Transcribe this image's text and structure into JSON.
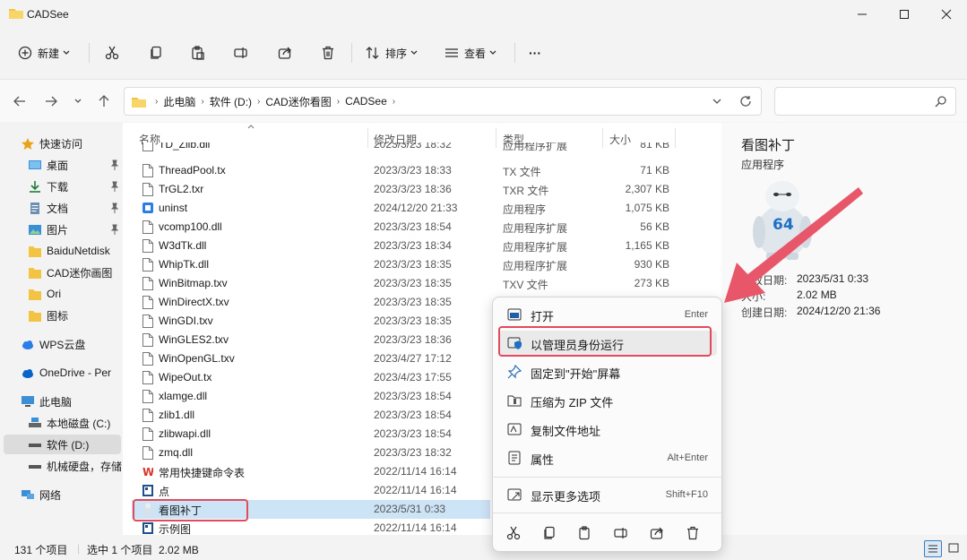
{
  "window": {
    "title": "CADSee"
  },
  "toolbar": {
    "new_label": "新建",
    "sort_label": "排序",
    "view_label": "查看",
    "more_label": "···"
  },
  "address": {
    "crumbs": [
      "此电脑",
      "软件 (D:)",
      "CAD迷你看图",
      "CADSee"
    ]
  },
  "sidebar": {
    "items": [
      {
        "label": "快速访问",
        "icon": "star-icon",
        "pinned": false
      },
      {
        "label": "桌面",
        "icon": "desktop-icon",
        "pinned": true
      },
      {
        "label": "下载",
        "icon": "download-icon",
        "pinned": true
      },
      {
        "label": "文档",
        "icon": "documents-icon",
        "pinned": true
      },
      {
        "label": "图片",
        "icon": "pictures-icon",
        "pinned": true
      },
      {
        "label": "BaiduNetdisk",
        "icon": "folder-icon",
        "pinned": false
      },
      {
        "label": "CAD迷你画图",
        "icon": "folder-icon",
        "pinned": false
      },
      {
        "label": "Ori",
        "icon": "folder-icon",
        "pinned": false
      },
      {
        "label": "图标",
        "icon": "folder-icon",
        "pinned": false
      },
      {
        "label": "WPS云盘",
        "icon": "cloud-icon",
        "pinned": false
      },
      {
        "label": "OneDrive - Per",
        "icon": "cloud-icon",
        "pinned": false
      },
      {
        "label": "此电脑",
        "icon": "computer-icon",
        "pinned": false
      },
      {
        "label": "本地磁盘 (C:)",
        "icon": "drive-icon",
        "pinned": false
      },
      {
        "label": "软件 (D:)",
        "icon": "drive-icon",
        "pinned": false
      },
      {
        "label": "机械硬盘，存储",
        "icon": "drive-icon",
        "pinned": false
      },
      {
        "label": "网络",
        "icon": "network-icon",
        "pinned": false
      }
    ]
  },
  "filelist": {
    "headers": {
      "name": "名称",
      "date": "修改日期",
      "type": "类型",
      "size": "大小"
    },
    "rows": [
      {
        "name": "TD_Zlib.dll",
        "date": "2023/3/23 18:32",
        "type": "应用程序扩展",
        "size": "81 KB",
        "icon": "file-icon"
      },
      {
        "name": "ThreadPool.tx",
        "date": "2023/3/23 18:33",
        "type": "TX 文件",
        "size": "71 KB",
        "icon": "file-icon"
      },
      {
        "name": "TrGL2.txr",
        "date": "2023/3/23 18:36",
        "type": "TXR 文件",
        "size": "2,307 KB",
        "icon": "file-icon"
      },
      {
        "name": "uninst",
        "date": "2024/12/20 21:33",
        "type": "应用程序",
        "size": "1,075 KB",
        "icon": "uninstaller-icon"
      },
      {
        "name": "vcomp100.dll",
        "date": "2023/3/23 18:54",
        "type": "应用程序扩展",
        "size": "56 KB",
        "icon": "file-icon"
      },
      {
        "name": "W3dTk.dll",
        "date": "2023/3/23 18:34",
        "type": "应用程序扩展",
        "size": "1,165 KB",
        "icon": "file-icon"
      },
      {
        "name": "WhipTk.dll",
        "date": "2023/3/23 18:35",
        "type": "应用程序扩展",
        "size": "930 KB",
        "icon": "file-icon"
      },
      {
        "name": "WinBitmap.txv",
        "date": "2023/3/23 18:35",
        "type": "TXV 文件",
        "size": "273 KB",
        "icon": "file-icon"
      },
      {
        "name": "WinDirectX.txv",
        "date": "2023/3/23 18:35",
        "type": "",
        "size": "",
        "icon": "file-icon"
      },
      {
        "name": "WinGDI.txv",
        "date": "2023/3/23 18:35",
        "type": "",
        "size": "",
        "icon": "file-icon"
      },
      {
        "name": "WinGLES2.txv",
        "date": "2023/3/23 18:36",
        "type": "",
        "size": "",
        "icon": "file-icon"
      },
      {
        "name": "WinOpenGL.txv",
        "date": "2023/4/27 17:12",
        "type": "",
        "size": "",
        "icon": "file-icon"
      },
      {
        "name": "WipeOut.tx",
        "date": "2023/4/23 17:55",
        "type": "",
        "size": "",
        "icon": "file-icon"
      },
      {
        "name": "xlamge.dll",
        "date": "2023/3/23 18:54",
        "type": "",
        "size": "",
        "icon": "file-icon"
      },
      {
        "name": "zlib1.dll",
        "date": "2023/3/23 18:54",
        "type": "",
        "size": "",
        "icon": "file-icon"
      },
      {
        "name": "zlibwapi.dll",
        "date": "2023/3/23 18:54",
        "type": "",
        "size": "",
        "icon": "file-icon"
      },
      {
        "name": "zmq.dll",
        "date": "2023/3/23 18:32",
        "type": "",
        "size": "",
        "icon": "file-icon"
      },
      {
        "name": "常用快捷键命令表",
        "date": "2022/11/14 16:14",
        "type": "",
        "size": "",
        "icon": "wps-doc-icon"
      },
      {
        "name": "点",
        "date": "2022/11/14 16:14",
        "type": "",
        "size": "",
        "icon": "image-file-icon"
      },
      {
        "name": "看图补丁",
        "date": "2023/5/31 0:33",
        "type": "",
        "size": "",
        "icon": "app-patch-icon"
      },
      {
        "name": "示例图",
        "date": "2022/11/14 16:14",
        "type": "",
        "size": "",
        "icon": "image-file-icon"
      }
    ]
  },
  "preview": {
    "name": "看图补丁",
    "type": "应用程序",
    "badge_text": "64",
    "props": [
      {
        "key": "修改日期:",
        "value": "2023/5/31 0:33"
      },
      {
        "key": "大小:",
        "value": "2.02 MB"
      },
      {
        "key": "创建日期:",
        "value": "2024/12/20 21:36"
      }
    ]
  },
  "context_menu": {
    "items": [
      {
        "label": "打开",
        "shortcut": "Enter",
        "icon": "open-icon"
      },
      {
        "label": "以管理员身份运行",
        "shortcut": "",
        "icon": "admin-shield-icon"
      },
      {
        "label": "固定到\"开始\"屏幕",
        "shortcut": "",
        "icon": "pin-icon"
      },
      {
        "label": "压缩为 ZIP 文件",
        "shortcut": "",
        "icon": "zip-icon"
      },
      {
        "label": "复制文件地址",
        "shortcut": "",
        "icon": "copy-path-icon"
      },
      {
        "label": "属性",
        "shortcut": "Alt+Enter",
        "icon": "properties-icon"
      },
      {
        "label": "显示更多选项",
        "shortcut": "Shift+F10",
        "icon": "more-options-icon"
      }
    ]
  },
  "status": {
    "count": "131 个项目",
    "selected": "选中 1 个项目  2.02 MB"
  },
  "colors": {
    "accent": "#0067c0",
    "highlight_box": "#e24b5e",
    "arrow": "#e8566a",
    "folder": "#f3c443"
  }
}
